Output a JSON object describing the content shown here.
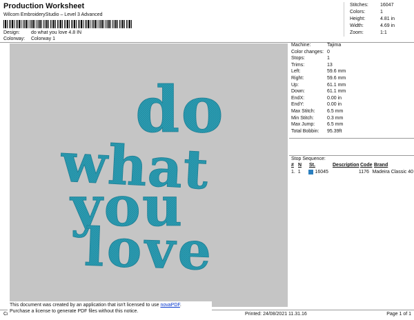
{
  "header": {
    "title": "Production Worksheet",
    "subtitle": "Wilcom EmbroideryStudio – Level 3 Advanced",
    "design_label": "Design:",
    "design_value": "do what you love 4.8 IN",
    "colorway_label": "Colorway:",
    "colorway_value": "Colorway 1"
  },
  "top_stats": [
    {
      "label": "Stitches:",
      "value": "16047"
    },
    {
      "label": "Colors:",
      "value": "1"
    },
    {
      "label": "Height:",
      "value": "4.81 in"
    },
    {
      "label": "Width:",
      "value": "4.69 in"
    },
    {
      "label": "Zoom:",
      "value": "1:1"
    }
  ],
  "design_text": [
    "do",
    "what",
    "you",
    "love"
  ],
  "thread_color": "#2b9db3",
  "info": [
    {
      "label": "Machine:",
      "value": "Tajima"
    },
    {
      "label": "Color changes:",
      "value": "0"
    },
    {
      "label": "Stops:",
      "value": "1"
    },
    {
      "label": "Trims:",
      "value": "13"
    },
    {
      "label": "Left:",
      "value": "59.6 mm"
    },
    {
      "label": "Right:",
      "value": "59.6 mm"
    },
    {
      "label": "Up:",
      "value": "61.1 mm"
    },
    {
      "label": "Down:",
      "value": "61.1 mm"
    },
    {
      "label": "EndX:",
      "value": "0.00 in"
    },
    {
      "label": "EndY:",
      "value": "0.00 in"
    },
    {
      "label": "Max Stitch:",
      "value": "6.5 mm"
    },
    {
      "label": "Min Stitch:",
      "value": "0.3 mm"
    },
    {
      "label": "Max Jump:",
      "value": "6.5 mm"
    },
    {
      "label": "Total Bobbin:",
      "value": "95.39ft"
    }
  ],
  "stop_sequence": {
    "title": "Stop Sequence:",
    "headers": {
      "num": "#",
      "n": "N",
      "st": "St.",
      "description": "Description",
      "code": "Code",
      "brand": "Brand"
    },
    "rows": [
      {
        "num": "1.",
        "n": "1",
        "st": "16045",
        "description": "",
        "code": "1176",
        "brand": "Madeira Classic 40"
      }
    ]
  },
  "notice": {
    "line1": "This document was created by an application that isn't licensed to use",
    "link": "novaPDF",
    "line1_end": ".",
    "line2": "Purchase a license to generate PDF files without this notice."
  },
  "footer": {
    "left": "Cr",
    "printed": "Printed: 24/08/2021 11.31.16",
    "page": "Page 1 of 1"
  }
}
